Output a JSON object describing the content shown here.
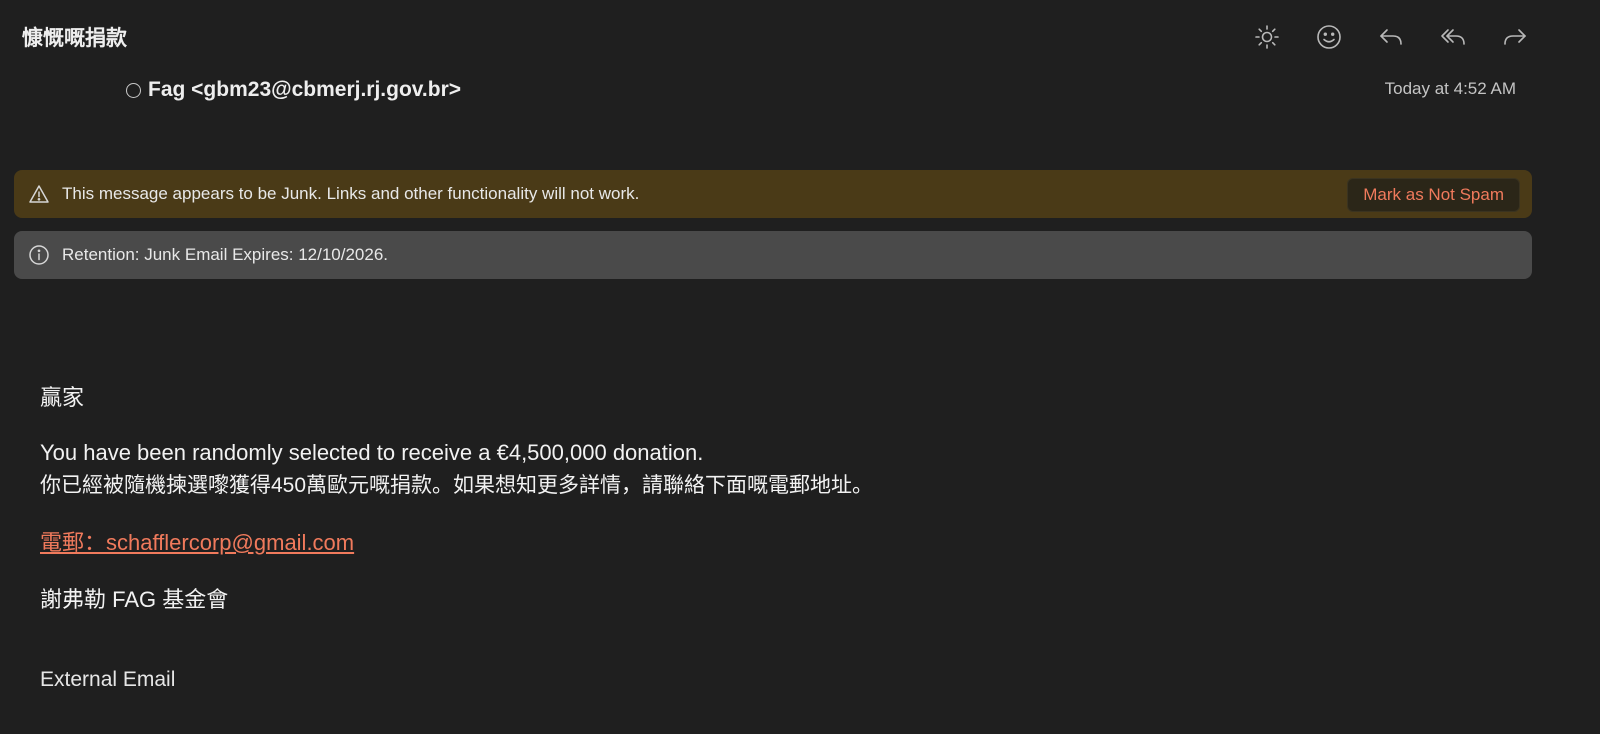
{
  "message": {
    "subject": "慷慨嘅捐款",
    "sender": "Fag <gbm23@cbmerj.rj.gov.br>",
    "timestamp": "Today at 4:52 AM"
  },
  "toolbar": {
    "icons": [
      "brightness-icon",
      "emoji-icon",
      "reply-icon",
      "reply-all-icon",
      "forward-icon"
    ]
  },
  "banners": {
    "junk_text": "This message appears to be Junk. Links and other functionality will not work.",
    "not_spam_label": "Mark as Not Spam",
    "retention_text": "Retention: Junk Email Expires: 12/10/2026."
  },
  "body": {
    "greeting": "贏家",
    "line1": "You have been randomly selected to receive a €4,500,000 donation.",
    "line2": "你已經被隨機揀選嚟獲得450萬歐元嘅捐款。如果想知更多詳情，請聯絡下面嘅電郵地址。",
    "email_link": "電郵：schafflercorp@gmail.com",
    "signature": "謝弗勒 FAG 基金會",
    "footer": "External Email"
  },
  "colors": {
    "background": "#1f1f1f",
    "junk_banner": "#4a3a17",
    "retention_banner": "#4a4a4a",
    "accent": "#f07a5c"
  }
}
